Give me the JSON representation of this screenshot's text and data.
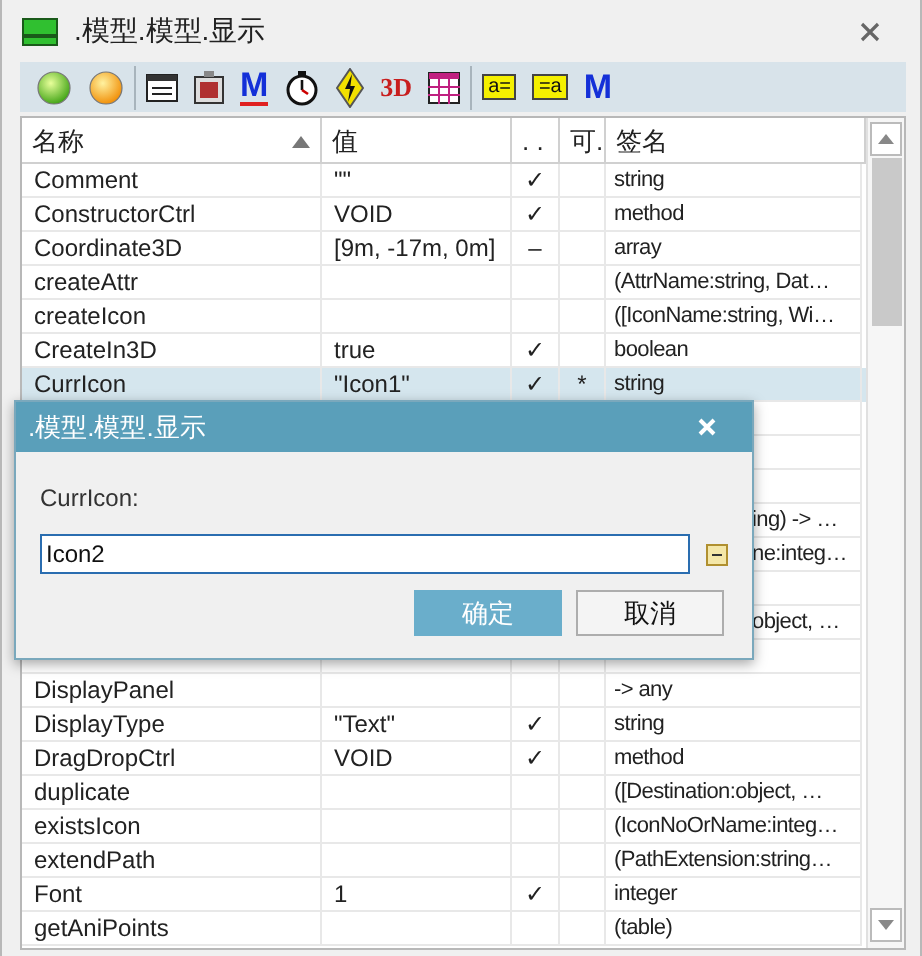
{
  "window": {
    "title": ".模型.模型.显示"
  },
  "toolbar": [
    [
      {
        "kind": "green-light"
      },
      {
        "kind": "orange-light"
      }
    ],
    [
      {
        "kind": "form"
      },
      {
        "kind": "frame"
      },
      {
        "kind": "mark",
        "label": "M"
      },
      {
        "kind": "stopwatch"
      },
      {
        "kind": "bolt"
      },
      {
        "kind": "red-text",
        "label": "3D"
      },
      {
        "kind": "grid"
      }
    ],
    [
      {
        "kind": "tag",
        "label": "a="
      },
      {
        "kind": "tag",
        "label": "=a"
      },
      {
        "kind": "blue-text",
        "label": "M"
      }
    ]
  ],
  "table": {
    "columns": [
      {
        "label": "名称",
        "sorted": true
      },
      {
        "label": "值"
      },
      {
        "label": ". ."
      },
      {
        "label": "可."
      },
      {
        "label": "签名"
      }
    ],
    "rows": [
      {
        "kind": "full",
        "name": "Comment",
        "value": "\"\"",
        "flag": "✓",
        "sig": "string",
        "selected": false
      },
      {
        "kind": "full",
        "name": "ConstructorCtrl",
        "value": "VOID",
        "flag": "✓",
        "sig": "method",
        "selected": false
      },
      {
        "kind": "full",
        "name": "Coordinate3D",
        "value": "[9m, -17m, 0m]",
        "flag": "–",
        "sig": "array",
        "selected": false
      },
      {
        "kind": "full",
        "name": "createAttr",
        "sig": "(AttrName:string, Dat…",
        "selected": false
      },
      {
        "kind": "full",
        "name": "createIcon",
        "sig": "([IconName:string, Wi…",
        "selected": false
      },
      {
        "kind": "full",
        "name": "CreateIn3D",
        "value": "true",
        "flag": "✓",
        "sig": "boolean",
        "selected": false
      },
      {
        "kind": "full",
        "name": "CurrIcon",
        "value": "\"Icon1\"",
        "flag": "✓",
        "star": "*",
        "sig": "string",
        "selected": true
      },
      {
        "kind": "covered",
        "selected": false
      },
      {
        "kind": "covered",
        "selected": false
      },
      {
        "kind": "covered",
        "selected": false
      },
      {
        "kind": "covered",
        "sig": "ing) -> …",
        "selected": false
      },
      {
        "kind": "covered",
        "sig": "ne:integ…",
        "selected": false
      },
      {
        "kind": "covered",
        "selected": false
      },
      {
        "kind": "covered",
        "sig": "object, …",
        "selected": false
      },
      {
        "kind": "covered",
        "selected": false
      },
      {
        "kind": "full",
        "name": "DisplayPanel",
        "sig": "-> any",
        "selected": false
      },
      {
        "kind": "full",
        "name": "DisplayType",
        "value": "\"Text\"",
        "flag": "✓",
        "sig": "string",
        "selected": false
      },
      {
        "kind": "full",
        "name": "DragDropCtrl",
        "value": "VOID",
        "flag": "✓",
        "sig": "method",
        "selected": false
      },
      {
        "kind": "full",
        "name": "duplicate",
        "sig": "([Destination:object, …",
        "selected": false
      },
      {
        "kind": "full",
        "name": "existsIcon",
        "sig": "(IconNoOrName:integ…",
        "selected": false
      },
      {
        "kind": "full",
        "name": "extendPath",
        "sig": "(PathExtension:string…",
        "selected": false
      },
      {
        "kind": "full",
        "name": "Font",
        "value": "1",
        "flag": "✓",
        "sig": "integer",
        "selected": false
      },
      {
        "kind": "full",
        "name": "getAniPoints",
        "sig": "(table)",
        "selected": false
      }
    ]
  },
  "dialog": {
    "title": ".模型.模型.显示",
    "label": "CurrIcon:",
    "value": "Icon2",
    "buttons": [
      {
        "label": "确定",
        "kind": "primary"
      },
      {
        "label": "取消",
        "kind": "secondary"
      }
    ]
  }
}
